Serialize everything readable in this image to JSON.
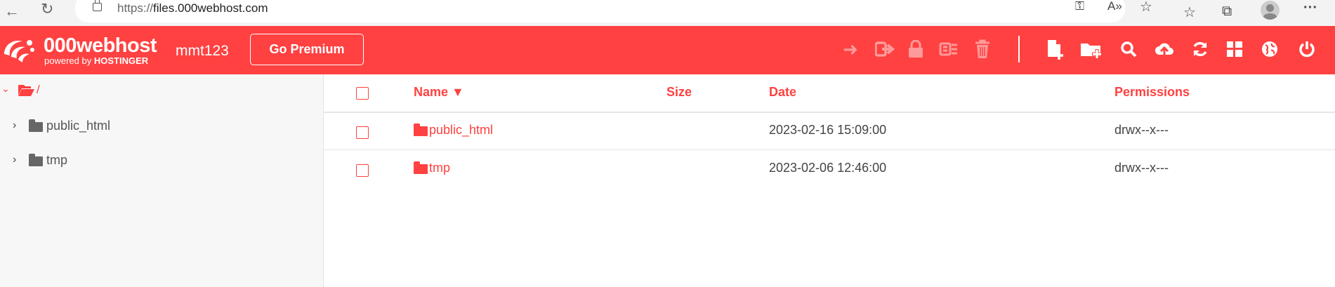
{
  "browser": {
    "url_scheme": "https://",
    "url_host": "files.000webhost.com",
    "icons": [
      "back-icon",
      "reload-icon",
      "lock-icon",
      "key-icon",
      "read-aloud-icon",
      "favorite-add-icon",
      "favorites-icon",
      "collections-icon",
      "profile-icon",
      "more-icon"
    ]
  },
  "header": {
    "brand": "000webhost",
    "powered_by": "powered by",
    "hostinger": "HOSTINGER",
    "username": "mmt123",
    "premium_label": "Go Premium",
    "colors": {
      "brand": "#ff4141",
      "dim_icon": "#ff9a9a"
    }
  },
  "sidebar": {
    "root_label": "/",
    "items": [
      {
        "label": "public_html"
      },
      {
        "label": "tmp"
      }
    ]
  },
  "table": {
    "columns": {
      "name": "Name ▼",
      "size": "Size",
      "date": "Date",
      "permissions": "Permissions"
    },
    "rows": [
      {
        "name": "public_html",
        "size": "",
        "date": "2023-02-16 15:09:00",
        "permissions": "drwx--x---"
      },
      {
        "name": "tmp",
        "size": "",
        "date": "2023-02-06 12:46:00",
        "permissions": "drwx--x---"
      }
    ]
  }
}
